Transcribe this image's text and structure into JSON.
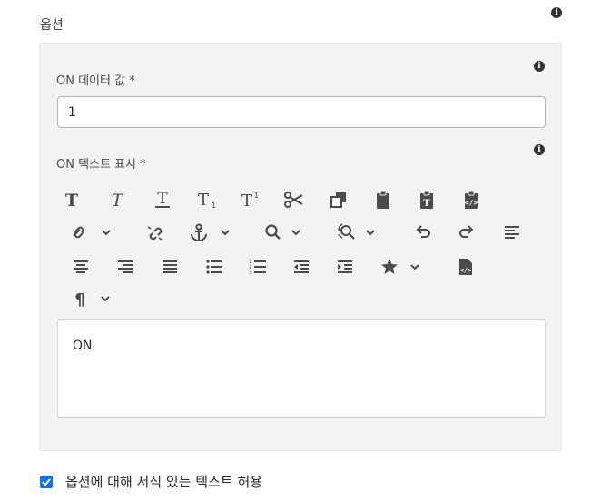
{
  "section": {
    "title": "옵션"
  },
  "on_value": {
    "label": "ON 데이터 값 *",
    "value": "1"
  },
  "on_text": {
    "label": "ON 텍스트 표시 *"
  },
  "toolbar": {
    "row1": [
      "bold-icon",
      "italic-icon",
      "underline-icon",
      "subscript-icon",
      "superscript-icon",
      "cut-icon",
      "copy-icon",
      "paste-icon",
      "paste-text-icon",
      "paste-html-icon"
    ],
    "row2": [
      "link-icon",
      "unlink-icon",
      "anchor-icon",
      "find-icon",
      "find-replace-icon",
      "undo-icon",
      "redo-icon",
      "align-left-icon"
    ],
    "row3": [
      "align-center-icon",
      "align-right-icon",
      "justify-icon",
      "bullet-list-icon",
      "numbered-list-icon",
      "outdent-icon",
      "indent-icon",
      "special-char-icon",
      "source-edit-icon"
    ],
    "row4": [
      "paragraph-format-icon"
    ]
  },
  "editor": {
    "content": "ON"
  },
  "rich_text_option": {
    "label": "옵션에 대해 서식 있는 텍스트 허용",
    "checked": true
  },
  "colors": {
    "accent": "#1473e6",
    "panel_bg": "#f3f3f3",
    "icon": "#4b4b4b"
  }
}
